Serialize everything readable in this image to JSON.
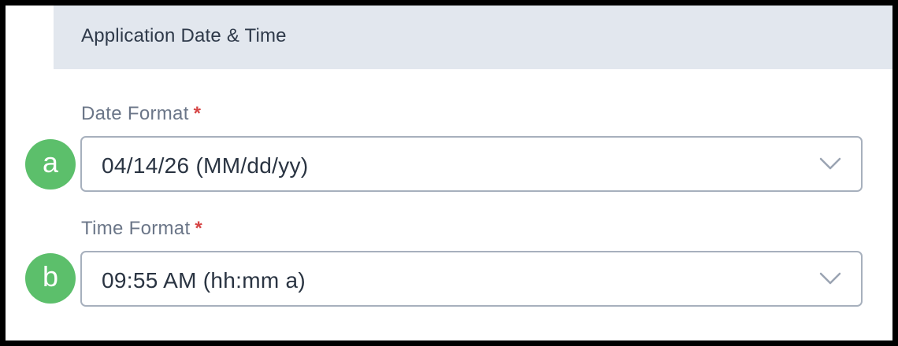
{
  "section": {
    "title": "Application Date & Time"
  },
  "date_format": {
    "label": "Date Format",
    "required_marker": "*",
    "selected_value": "04/14/26 (MM/dd/yy)",
    "callout": "a"
  },
  "time_format": {
    "label": "Time Format",
    "required_marker": "*",
    "selected_value": "09:55 AM (hh:mm a)",
    "callout": "b"
  },
  "colors": {
    "header_bg": "#e2e7ee",
    "badge": "#5cbf6b",
    "required": "#d64545",
    "border": "#a7b0bd"
  },
  "icons": {
    "dropdown": "chevron-down-icon"
  }
}
